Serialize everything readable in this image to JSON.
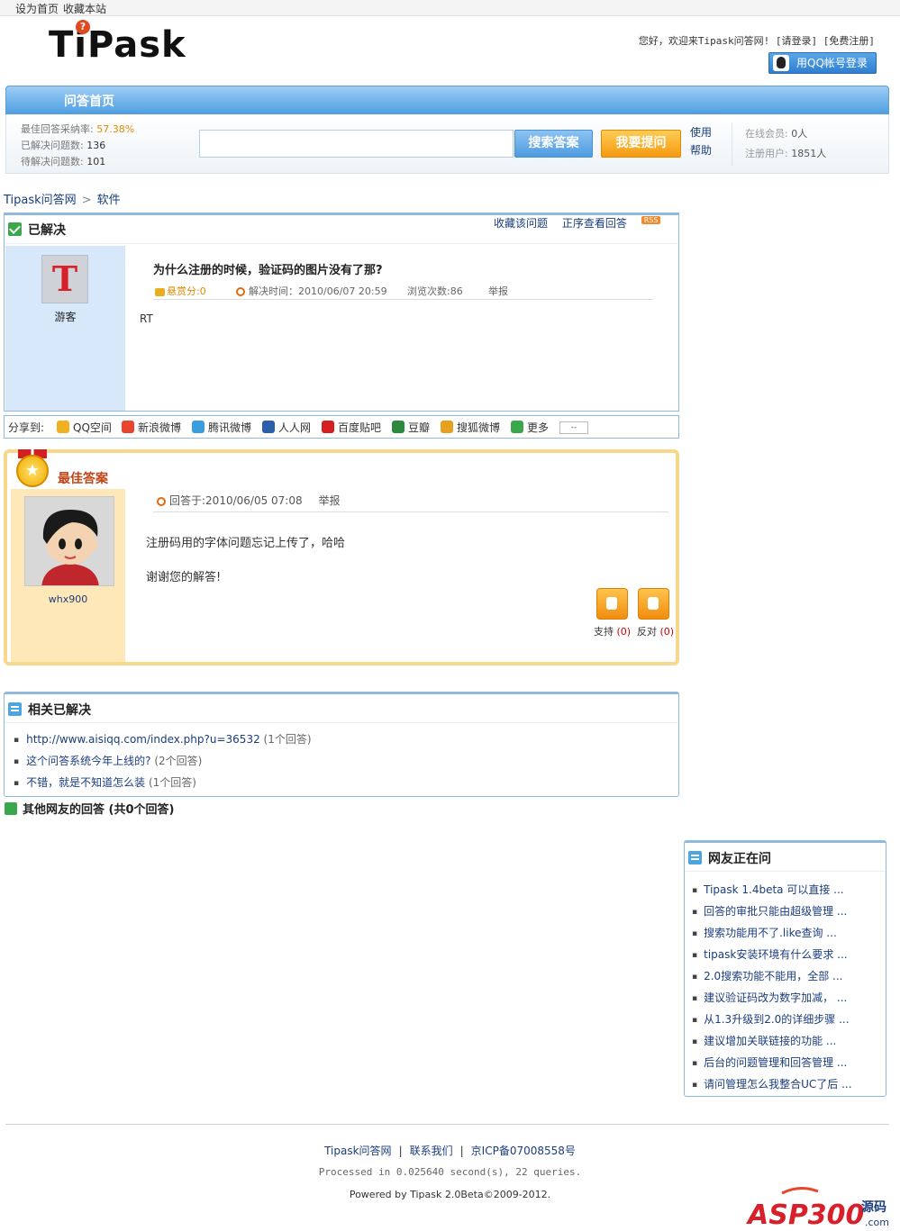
{
  "topbar": {
    "set_home": "设为首页",
    "bookmark": "收藏本站"
  },
  "header": {
    "logo_text": "TiPask",
    "welcome": "您好，欢迎来Tipask问答网! [请登录] [免费注册]",
    "qq_login": "用QQ帐号登录"
  },
  "nav": {
    "home": "问答首页"
  },
  "stats": {
    "best_rate_label": "最佳回答采纳率:",
    "best_rate_value": "57.38%",
    "solved_label": "已解决问题数:",
    "solved_value": "136",
    "pending_label": "待解决问题数:",
    "pending_value": "101"
  },
  "search": {
    "button": "搜索答案",
    "ask_button": "我要提问",
    "help": "使用帮助"
  },
  "online": {
    "members_label": "在线会员:",
    "members_value": "0人",
    "registered_label": "注册用户:",
    "registered_value": "1851人"
  },
  "breadcrumb": [
    "Tipask问答网",
    "软件"
  ],
  "question": {
    "status": "已解决",
    "action_favorite": "收藏该问题",
    "action_order": "正序查看回答",
    "rss": "RSS",
    "user": "游客",
    "avatar_letter": "T",
    "title": "为什么注册的时候，验证码的图片没有了那?",
    "reward": "悬赏分:0",
    "solved_time": "解决时间：2010/06/07 20:59",
    "views": "浏览次数:86",
    "report": "举报",
    "body": "RT"
  },
  "share": {
    "label": "分享到:",
    "items": [
      "QQ空间",
      "新浪微博",
      "腾讯微博",
      "人人网",
      "百度贴吧",
      "豆瓣",
      "搜狐微博",
      "更多"
    ],
    "more_box": "--",
    "colors": [
      "#f0b020",
      "#e8452c",
      "#3a9de0",
      "#2a5ea8",
      "#d42020",
      "#2b8a3e",
      "#e8a020",
      "#3aa84a"
    ]
  },
  "best_answer": {
    "title": "最佳答案",
    "user": "whx900",
    "answered_at": "回答于:2010/06/05 07:08",
    "report": "举报",
    "content_1": "注册码用的字体问题忘记上传了，哈哈",
    "content_2": "谢谢您的解答!",
    "support_label": "支持",
    "support_count": "(0)",
    "oppose_label": "反对",
    "oppose_count": "(0)"
  },
  "related": {
    "title": "相关已解决",
    "items": [
      {
        "text": "http://www.aisiqq.com/index.php?u=36532",
        "count": "(1个回答)"
      },
      {
        "text": "这个问答系统今年上线的?",
        "count": "(2个回答)"
      },
      {
        "text": "不错，就是不知道怎么装",
        "count": "(1个回答)"
      }
    ]
  },
  "others": {
    "title": "其他网友的回答 (共0个回答)"
  },
  "sidebar": {
    "title": "网友正在问",
    "items": [
      "Tipask 1.4beta 可以直接 ...",
      "回答的审批只能由超级管理 ...",
      "搜索功能用不了.like查询 ...",
      "tipask安装环境有什么要求 ...",
      "2.0搜索功能不能用，全部 ...",
      "建议验证码改为数字加减，  ...",
      "从1.3升级到2.0的详细步骤 ...",
      "建议增加关联链接的功能 ...",
      "后台的问题管理和回答管理 ...",
      "请问管理怎么我整合UC了后 ..."
    ]
  },
  "footer": {
    "site": "Tipask问答网",
    "contact": "联系我们",
    "icp": "京ICP备07008558号",
    "processed": "Processed in 0.025640 second(s), 22 queries.",
    "powered": "Powered by Tipask 2.0Beta©2009-2012.",
    "watermark": "ASP300",
    "watermark_sub": "源码"
  }
}
